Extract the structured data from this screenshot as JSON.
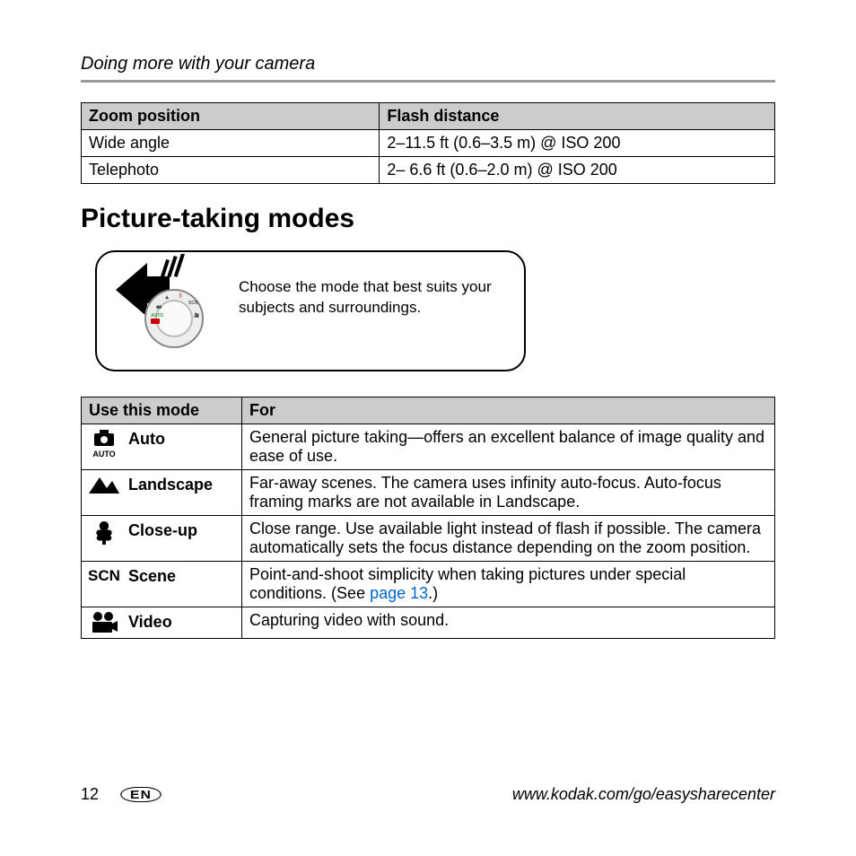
{
  "header": "Doing more with your camera",
  "zoom_table": {
    "col1": "Zoom position",
    "col2": "Flash distance",
    "rows": [
      {
        "c1": "Wide angle",
        "c2": "2–11.5 ft (0.6–3.5 m) @ ISO 200"
      },
      {
        "c1": "Telephoto",
        "c2": "2– 6.6 ft (0.6–2.0 m) @ ISO 200"
      }
    ]
  },
  "heading": "Picture-taking modes",
  "callout_text": "Choose the mode that best suits your subjects and surroundings.",
  "modes_table": {
    "col1": "Use this mode",
    "col2": "For",
    "rows": [
      {
        "icon": "auto-icon",
        "label": "Auto",
        "desc_pre": "General picture taking—offers an excellent balance of image quality and ease of use.",
        "link": "",
        "desc_post": ""
      },
      {
        "icon": "landscape-icon",
        "label": "Landscape",
        "desc_pre": "Far-away scenes. The camera uses infinity auto-focus. Auto-focus framing marks are not available in Landscape.",
        "link": "",
        "desc_post": ""
      },
      {
        "icon": "closeup-icon",
        "label": "Close-up",
        "desc_pre": "Close range. Use available light instead of flash if possible. The camera automatically sets the focus distance depending on the zoom position.",
        "link": "",
        "desc_post": ""
      },
      {
        "icon": "scn-icon",
        "label": "Scene",
        "desc_pre": "Point-and-shoot simplicity when taking pictures under special conditions. (See ",
        "link": "page 13",
        "desc_post": ".)"
      },
      {
        "icon": "video-icon",
        "label": "Video",
        "desc_pre": "Capturing video with sound.",
        "link": "",
        "desc_post": ""
      }
    ]
  },
  "footer": {
    "page": "12",
    "lang": "EN",
    "url": "www.kodak.com/go/easysharecenter"
  }
}
